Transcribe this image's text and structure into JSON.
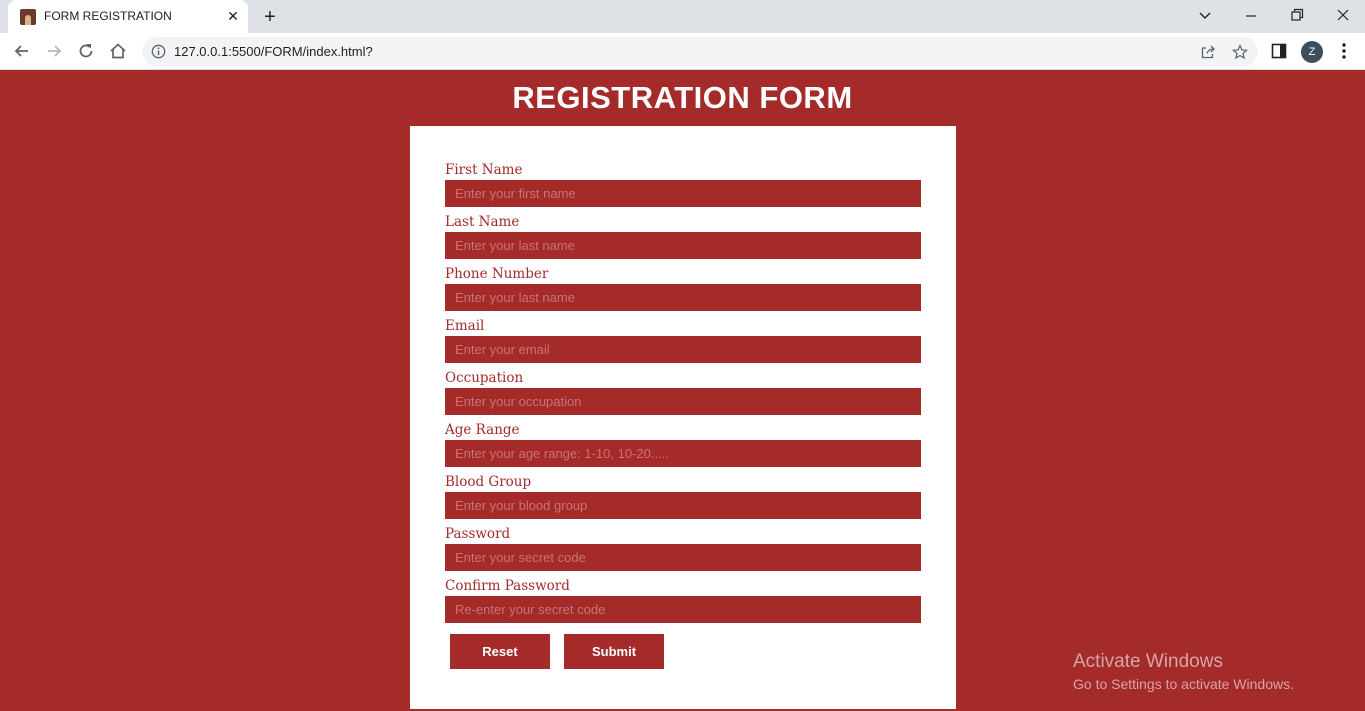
{
  "browser": {
    "tab_title": "FORM REGISTRATION",
    "close_glyph": "✕",
    "new_tab_glyph": "+",
    "url": "127.0.0.1:5500/FORM/index.html?",
    "avatar_letter": "Z"
  },
  "page": {
    "title": "REGISTRATION FORM",
    "background": "#a52a2a"
  },
  "form": {
    "fields": [
      {
        "label": "First Name",
        "placeholder": "Enter your first name"
      },
      {
        "label": "Last Name",
        "placeholder": "Enter your last name"
      },
      {
        "label": "Phone Number",
        "placeholder": "Enter your last name"
      },
      {
        "label": "Email",
        "placeholder": "Enter your email"
      },
      {
        "label": "Occupation",
        "placeholder": "Enter your occupation"
      },
      {
        "label": "Age Range",
        "placeholder": "Enter your age range: 1-10, 10-20....."
      },
      {
        "label": "Blood Group",
        "placeholder": "Enter your blood group"
      },
      {
        "label": "Password",
        "placeholder": "Enter your secret code"
      },
      {
        "label": "Confirm Password",
        "placeholder": "Re-enter your secret code"
      }
    ],
    "reset_label": "Reset",
    "submit_label": "Submit"
  },
  "watermark": {
    "title": "Activate Windows",
    "subtitle": "Go to Settings to activate Windows."
  }
}
